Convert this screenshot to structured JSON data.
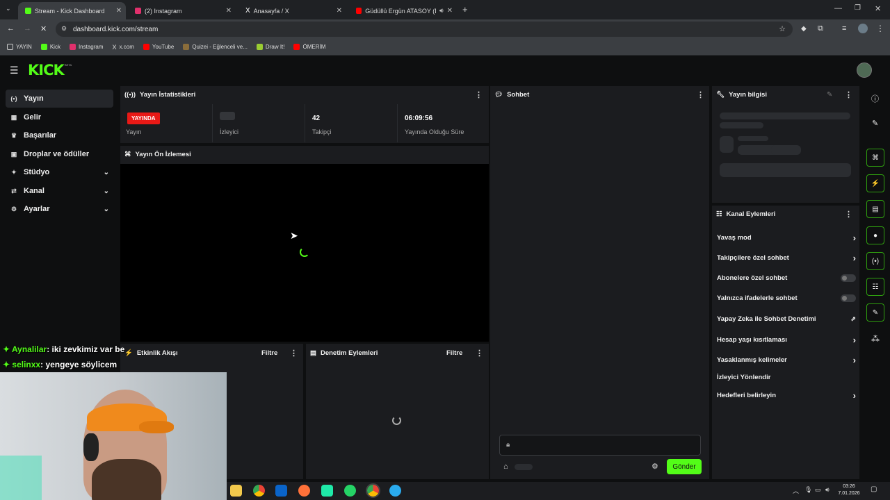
{
  "browser": {
    "tabs": [
      {
        "title": "Stream - Kick Dashboard",
        "icon_color": "#53fc18",
        "active": true
      },
      {
        "title": "(2) Instagram",
        "icon_color": "#e1306c",
        "active": false
      },
      {
        "title": "Anasayfa / X",
        "icon_color": "#ffffff",
        "active": false
      },
      {
        "title": "Güdüllü Ergün ATASOY (Da",
        "icon_color": "#ff0000",
        "active": false
      }
    ],
    "url": "dashboard.kick.com/stream",
    "bookmarks": [
      {
        "label": "YAYIN",
        "icon": "folder-icon"
      },
      {
        "label": "Kick",
        "icon": "kick-icon"
      },
      {
        "label": "Instagram",
        "icon": "instagram-icon"
      },
      {
        "label": "x.com",
        "icon": "x-icon"
      },
      {
        "label": "YouTube",
        "icon": "youtube-icon"
      },
      {
        "label": "Quizei - Eğlenceli ve...",
        "icon": "quizei-icon"
      },
      {
        "label": "Draw It!",
        "icon": "drawit-icon"
      },
      {
        "label": "ÖMERİM",
        "icon": "youtube-icon"
      }
    ]
  },
  "app": {
    "logo": "KICK",
    "logo_badge": "BETA",
    "accent": "#53fc18"
  },
  "sidebar": {
    "items": [
      {
        "label": "Yayın",
        "icon": "broadcast-icon",
        "active": true,
        "expandable": false
      },
      {
        "label": "Gelir",
        "icon": "revenue-icon",
        "active": false,
        "expandable": false
      },
      {
        "label": "Başarılar",
        "icon": "trophy-icon",
        "active": false,
        "expandable": false
      },
      {
        "label": "Droplar ve ödüller",
        "icon": "gift-icon",
        "active": false,
        "expandable": false
      },
      {
        "label": "Stüdyo",
        "icon": "studio-icon",
        "active": false,
        "expandable": true
      },
      {
        "label": "Kanal",
        "icon": "channel-icon",
        "active": false,
        "expandable": true
      },
      {
        "label": "Ayarlar",
        "icon": "gear-icon",
        "active": false,
        "expandable": true
      }
    ]
  },
  "stats": {
    "title": "Yayın İstatistikleri",
    "live_badge": "YAYINDA",
    "items": [
      {
        "label": "Yayın",
        "value": ""
      },
      {
        "label": "İzleyici",
        "value": ""
      },
      {
        "label": "Takipçi",
        "value": "42"
      },
      {
        "label": "Yayında Olduğu Süre",
        "value": "06:09:56"
      }
    ]
  },
  "preview": {
    "title": "Yayın Ön İzlemesi"
  },
  "activity": {
    "title": "Etkinlik Akışı",
    "filter": "Filtre"
  },
  "moderation": {
    "title": "Denetim Eylemleri",
    "filter": "Filtre"
  },
  "chat": {
    "title": "Sohbet",
    "send": "Gönder"
  },
  "stream_info": {
    "title": "Yayın bilgisi"
  },
  "channel_actions": {
    "title": "Kanal Eylemleri",
    "items": [
      {
        "label": "Yavaş mod",
        "control": "arrow"
      },
      {
        "label": "Takipçilere özel sohbet",
        "control": "arrow"
      },
      {
        "label": "Abonelere özel sohbet",
        "control": "toggle"
      },
      {
        "label": "Yalnızca ifadelerle sohbet",
        "control": "toggle"
      },
      {
        "label": "Yapay Zeka ile Sohbet Denetimi",
        "control": "external"
      },
      {
        "label": "Hesap yaşı kısıtlaması",
        "control": "arrow"
      },
      {
        "label": "Yasaklanmış kelimeler",
        "control": "arrow"
      },
      {
        "label": "İzleyici Yönlendir",
        "control": "none"
      },
      {
        "label": "Hedefleri belirleyin",
        "control": "arrow"
      }
    ]
  },
  "overlay_chat": [
    {
      "user": "Aynalilar",
      "message": ": iki zevkimiz var be",
      "color": "#53fc18"
    },
    {
      "user": "selinxx",
      "message": ": yengeye söylicem",
      "color": "#53fc18"
    }
  ],
  "system_tray": {
    "time": "03:26",
    "date": "7.01.2026"
  }
}
